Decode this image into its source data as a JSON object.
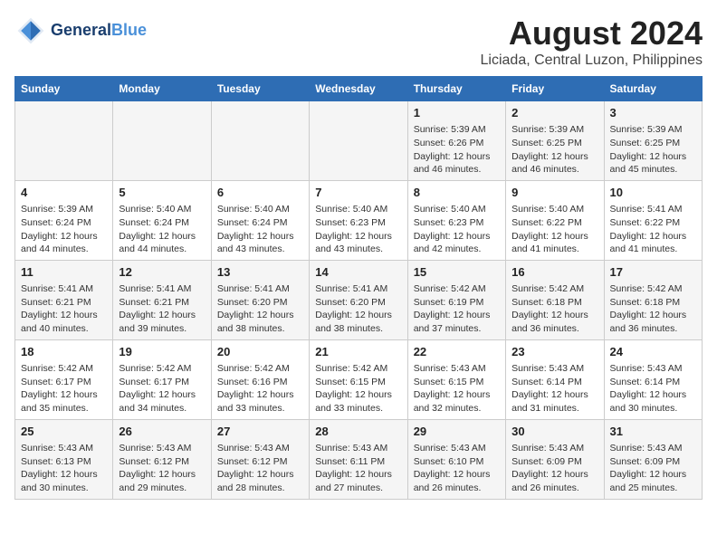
{
  "logo": {
    "line1": "General",
    "line2": "Blue"
  },
  "title": "August 2024",
  "subtitle": "Liciada, Central Luzon, Philippines",
  "days_of_week": [
    "Sunday",
    "Monday",
    "Tuesday",
    "Wednesday",
    "Thursday",
    "Friday",
    "Saturday"
  ],
  "weeks": [
    [
      {
        "day": "",
        "content": ""
      },
      {
        "day": "",
        "content": ""
      },
      {
        "day": "",
        "content": ""
      },
      {
        "day": "",
        "content": ""
      },
      {
        "day": "1",
        "content": "Sunrise: 5:39 AM\nSunset: 6:26 PM\nDaylight: 12 hours\nand 46 minutes."
      },
      {
        "day": "2",
        "content": "Sunrise: 5:39 AM\nSunset: 6:25 PM\nDaylight: 12 hours\nand 46 minutes."
      },
      {
        "day": "3",
        "content": "Sunrise: 5:39 AM\nSunset: 6:25 PM\nDaylight: 12 hours\nand 45 minutes."
      }
    ],
    [
      {
        "day": "4",
        "content": "Sunrise: 5:39 AM\nSunset: 6:24 PM\nDaylight: 12 hours\nand 44 minutes."
      },
      {
        "day": "5",
        "content": "Sunrise: 5:40 AM\nSunset: 6:24 PM\nDaylight: 12 hours\nand 44 minutes."
      },
      {
        "day": "6",
        "content": "Sunrise: 5:40 AM\nSunset: 6:24 PM\nDaylight: 12 hours\nand 43 minutes."
      },
      {
        "day": "7",
        "content": "Sunrise: 5:40 AM\nSunset: 6:23 PM\nDaylight: 12 hours\nand 43 minutes."
      },
      {
        "day": "8",
        "content": "Sunrise: 5:40 AM\nSunset: 6:23 PM\nDaylight: 12 hours\nand 42 minutes."
      },
      {
        "day": "9",
        "content": "Sunrise: 5:40 AM\nSunset: 6:22 PM\nDaylight: 12 hours\nand 41 minutes."
      },
      {
        "day": "10",
        "content": "Sunrise: 5:41 AM\nSunset: 6:22 PM\nDaylight: 12 hours\nand 41 minutes."
      }
    ],
    [
      {
        "day": "11",
        "content": "Sunrise: 5:41 AM\nSunset: 6:21 PM\nDaylight: 12 hours\nand 40 minutes."
      },
      {
        "day": "12",
        "content": "Sunrise: 5:41 AM\nSunset: 6:21 PM\nDaylight: 12 hours\nand 39 minutes."
      },
      {
        "day": "13",
        "content": "Sunrise: 5:41 AM\nSunset: 6:20 PM\nDaylight: 12 hours\nand 38 minutes."
      },
      {
        "day": "14",
        "content": "Sunrise: 5:41 AM\nSunset: 6:20 PM\nDaylight: 12 hours\nand 38 minutes."
      },
      {
        "day": "15",
        "content": "Sunrise: 5:42 AM\nSunset: 6:19 PM\nDaylight: 12 hours\nand 37 minutes."
      },
      {
        "day": "16",
        "content": "Sunrise: 5:42 AM\nSunset: 6:18 PM\nDaylight: 12 hours\nand 36 minutes."
      },
      {
        "day": "17",
        "content": "Sunrise: 5:42 AM\nSunset: 6:18 PM\nDaylight: 12 hours\nand 36 minutes."
      }
    ],
    [
      {
        "day": "18",
        "content": "Sunrise: 5:42 AM\nSunset: 6:17 PM\nDaylight: 12 hours\nand 35 minutes."
      },
      {
        "day": "19",
        "content": "Sunrise: 5:42 AM\nSunset: 6:17 PM\nDaylight: 12 hours\nand 34 minutes."
      },
      {
        "day": "20",
        "content": "Sunrise: 5:42 AM\nSunset: 6:16 PM\nDaylight: 12 hours\nand 33 minutes."
      },
      {
        "day": "21",
        "content": "Sunrise: 5:42 AM\nSunset: 6:15 PM\nDaylight: 12 hours\nand 33 minutes."
      },
      {
        "day": "22",
        "content": "Sunrise: 5:43 AM\nSunset: 6:15 PM\nDaylight: 12 hours\nand 32 minutes."
      },
      {
        "day": "23",
        "content": "Sunrise: 5:43 AM\nSunset: 6:14 PM\nDaylight: 12 hours\nand 31 minutes."
      },
      {
        "day": "24",
        "content": "Sunrise: 5:43 AM\nSunset: 6:14 PM\nDaylight: 12 hours\nand 30 minutes."
      }
    ],
    [
      {
        "day": "25",
        "content": "Sunrise: 5:43 AM\nSunset: 6:13 PM\nDaylight: 12 hours\nand 30 minutes."
      },
      {
        "day": "26",
        "content": "Sunrise: 5:43 AM\nSunset: 6:12 PM\nDaylight: 12 hours\nand 29 minutes."
      },
      {
        "day": "27",
        "content": "Sunrise: 5:43 AM\nSunset: 6:12 PM\nDaylight: 12 hours\nand 28 minutes."
      },
      {
        "day": "28",
        "content": "Sunrise: 5:43 AM\nSunset: 6:11 PM\nDaylight: 12 hours\nand 27 minutes."
      },
      {
        "day": "29",
        "content": "Sunrise: 5:43 AM\nSunset: 6:10 PM\nDaylight: 12 hours\nand 26 minutes."
      },
      {
        "day": "30",
        "content": "Sunrise: 5:43 AM\nSunset: 6:09 PM\nDaylight: 12 hours\nand 26 minutes."
      },
      {
        "day": "31",
        "content": "Sunrise: 5:43 AM\nSunset: 6:09 PM\nDaylight: 12 hours\nand 25 minutes."
      }
    ]
  ]
}
